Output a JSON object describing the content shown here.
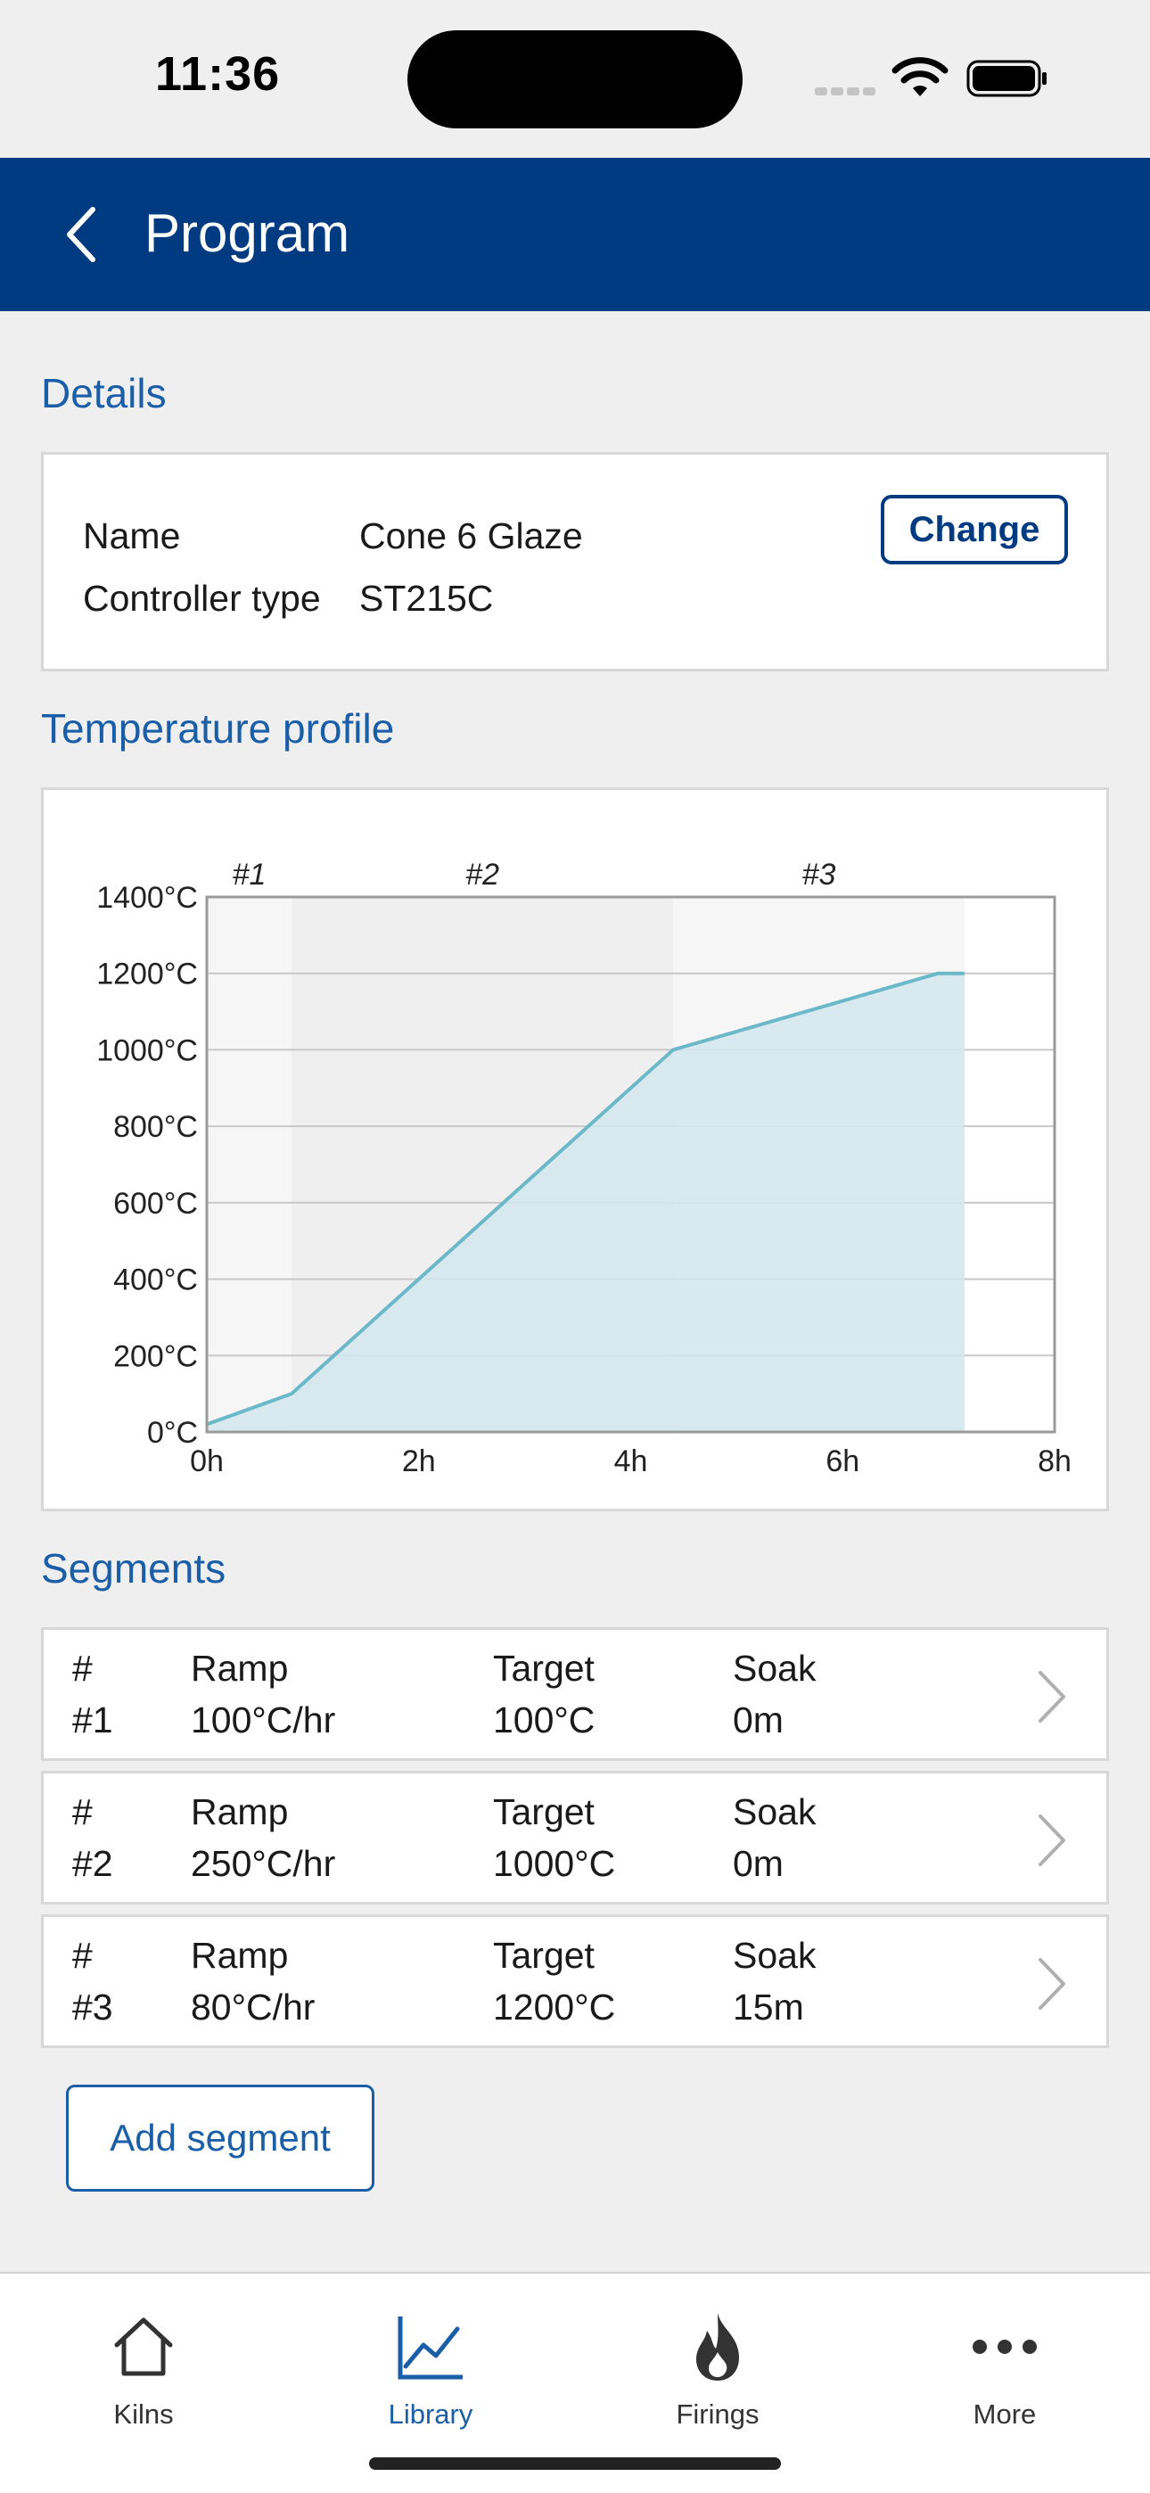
{
  "status_bar": {
    "time": "11:36",
    "icons": [
      "signal-icon",
      "wifi-icon",
      "battery-icon"
    ]
  },
  "header": {
    "title": "Program",
    "back_icon": "chevron-left-icon",
    "background": "#003a80"
  },
  "details": {
    "section_title": "Details",
    "name_label": "Name",
    "name_value": "Cone 6 Glaze",
    "controller_label": "Controller type",
    "controller_value": "ST215C",
    "change_label": "Change"
  },
  "temperature_profile": {
    "section_title": "Temperature profile"
  },
  "chart_data": {
    "type": "area",
    "title": "",
    "xlabel": "",
    "ylabel": "",
    "xlim": [
      0,
      8
    ],
    "ylim": [
      0,
      1400
    ],
    "x_ticks": [
      "0h",
      "2h",
      "4h",
      "6h",
      "8h"
    ],
    "y_ticks": [
      "0°C",
      "200°C",
      "400°C",
      "600°C",
      "800°C",
      "1000°C",
      "1200°C",
      "1400°C"
    ],
    "grid": true,
    "series": [
      {
        "x": [
          0,
          0.8,
          4.4,
          6.9,
          7.15
        ],
        "y": [
          20,
          100,
          1000,
          1200,
          1200
        ],
        "color": "#6bb8c8",
        "fill": "#d2e8ed"
      }
    ],
    "segment_bands": [
      {
        "label": "#1",
        "start": 0,
        "end": 0.8,
        "fill": "#f6f6f6"
      },
      {
        "label": "#2",
        "start": 0.8,
        "end": 4.4,
        "fill": "#efefef"
      },
      {
        "label": "#3",
        "start": 4.4,
        "end": 7.15,
        "fill": "#f6f6f6"
      }
    ]
  },
  "segments": {
    "section_title": "Segments",
    "headers": {
      "number": "#",
      "ramp": "Ramp",
      "target": "Target",
      "soak": "Soak"
    },
    "rows": [
      {
        "number": "#1",
        "ramp": "100°C/hr",
        "target": "100°C",
        "soak": "0m"
      },
      {
        "number": "#2",
        "ramp": "250°C/hr",
        "target": "1000°C",
        "soak": "0m"
      },
      {
        "number": "#3",
        "ramp": "80°C/hr",
        "target": "1200°C",
        "soak": "15m"
      }
    ],
    "add_label": "Add segment"
  },
  "tab_bar": {
    "tabs": [
      {
        "label": "Kilns",
        "icon": "home-icon",
        "active": false
      },
      {
        "label": "Library",
        "icon": "line-chart-icon",
        "active": true
      },
      {
        "label": "Firings",
        "icon": "flame-icon",
        "active": false
      },
      {
        "label": "More",
        "icon": "ellipsis-icon",
        "active": false
      }
    ],
    "active_color": "#1a5ea8"
  }
}
